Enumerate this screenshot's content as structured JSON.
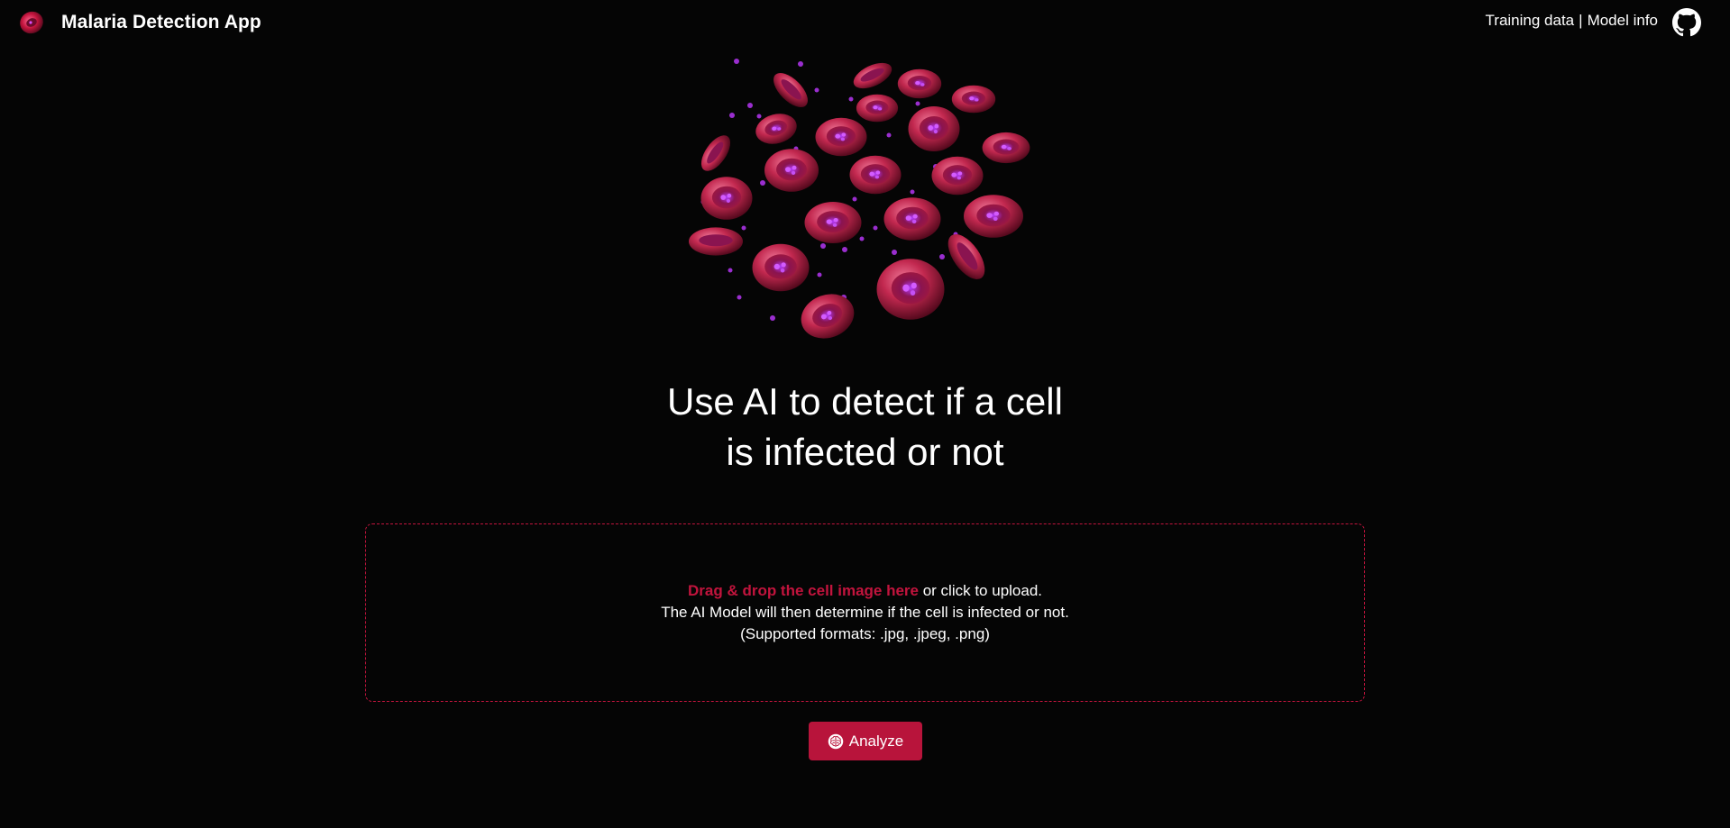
{
  "app": {
    "title": "Malaria Detection App"
  },
  "nav": {
    "training_data": "Training data",
    "separator": "|",
    "model_info": "Model info",
    "github_icon": "github-icon"
  },
  "hero": {
    "headline_line1": "Use AI to detect if a cell",
    "headline_line2": "is infected or not"
  },
  "upload": {
    "highlight": "Drag & drop the cell image here",
    "suffix": " or click to upload.",
    "line2": "The AI Model will then determine if the cell is infected or not.",
    "line3": "(Supported formats: .jpg, .jpeg, .png)"
  },
  "actions": {
    "analyze_label": "Analyze",
    "analyze_icon": "brain-icon"
  },
  "colors": {
    "accent": "#c2143d",
    "button": "#b8143b",
    "background": "#050505",
    "text": "#ffffff"
  }
}
